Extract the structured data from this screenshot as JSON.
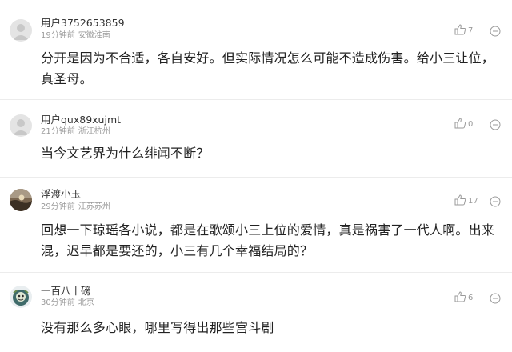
{
  "comments": [
    {
      "user": "用户3752653859",
      "time": "19分钟前",
      "location": "安徽淮南",
      "likes": "7",
      "text": "分开是因为不合适，各自安好。但实际情况怎么可能不造成伤害。给小三让位，真圣母。",
      "avatar": "default-avatar-icon"
    },
    {
      "user": "用户qux89xujmt",
      "time": "21分钟前",
      "location": "浙江杭州",
      "likes": "0",
      "text": "当今文艺界为什么绯闻不断？",
      "avatar": "default-avatar-icon"
    },
    {
      "user": "浮渡小玉",
      "time": "29分钟前",
      "location": "江苏苏州",
      "likes": "17",
      "text": "回想一下琼瑶各小说，都是在歌颂小三上位的爱情，真是祸害了一代人啊。出来混，迟早都是要还的，小三有几个幸福结局的？",
      "avatar": "sunset-photo-avatar"
    },
    {
      "user": "一百八十磅",
      "time": "30分钟前",
      "location": "北京",
      "likes": "6",
      "text": "没有那么多心眼，哪里写得出那些宫斗剧",
      "avatar": "cartoon-avatar"
    }
  ]
}
